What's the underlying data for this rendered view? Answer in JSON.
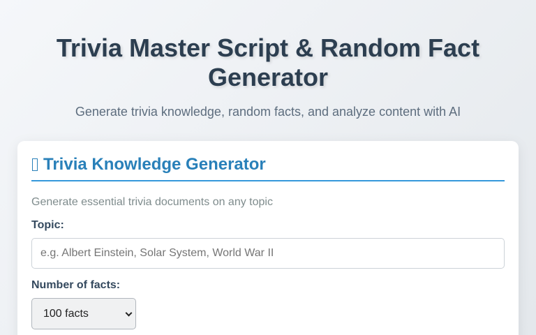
{
  "header": {
    "title": "Trivia Master Script & Random Fact Generator",
    "subtitle": "Generate trivia knowledge, random facts, and analyze content with AI"
  },
  "card": {
    "icon": "book-icon",
    "title": "Trivia Knowledge Generator",
    "description": "Generate essential trivia documents on any topic",
    "topic": {
      "label": "Topic:",
      "placeholder": "e.g. Albert Einstein, Solar System, World War II",
      "value": ""
    },
    "facts": {
      "label": "Number of facts:",
      "selected": "100 facts"
    }
  },
  "colors": {
    "title": "#2c3e50",
    "accent": "#2980b9",
    "accent_border": "#3498db",
    "label": "#34495e",
    "muted": "#7f8c8d"
  }
}
